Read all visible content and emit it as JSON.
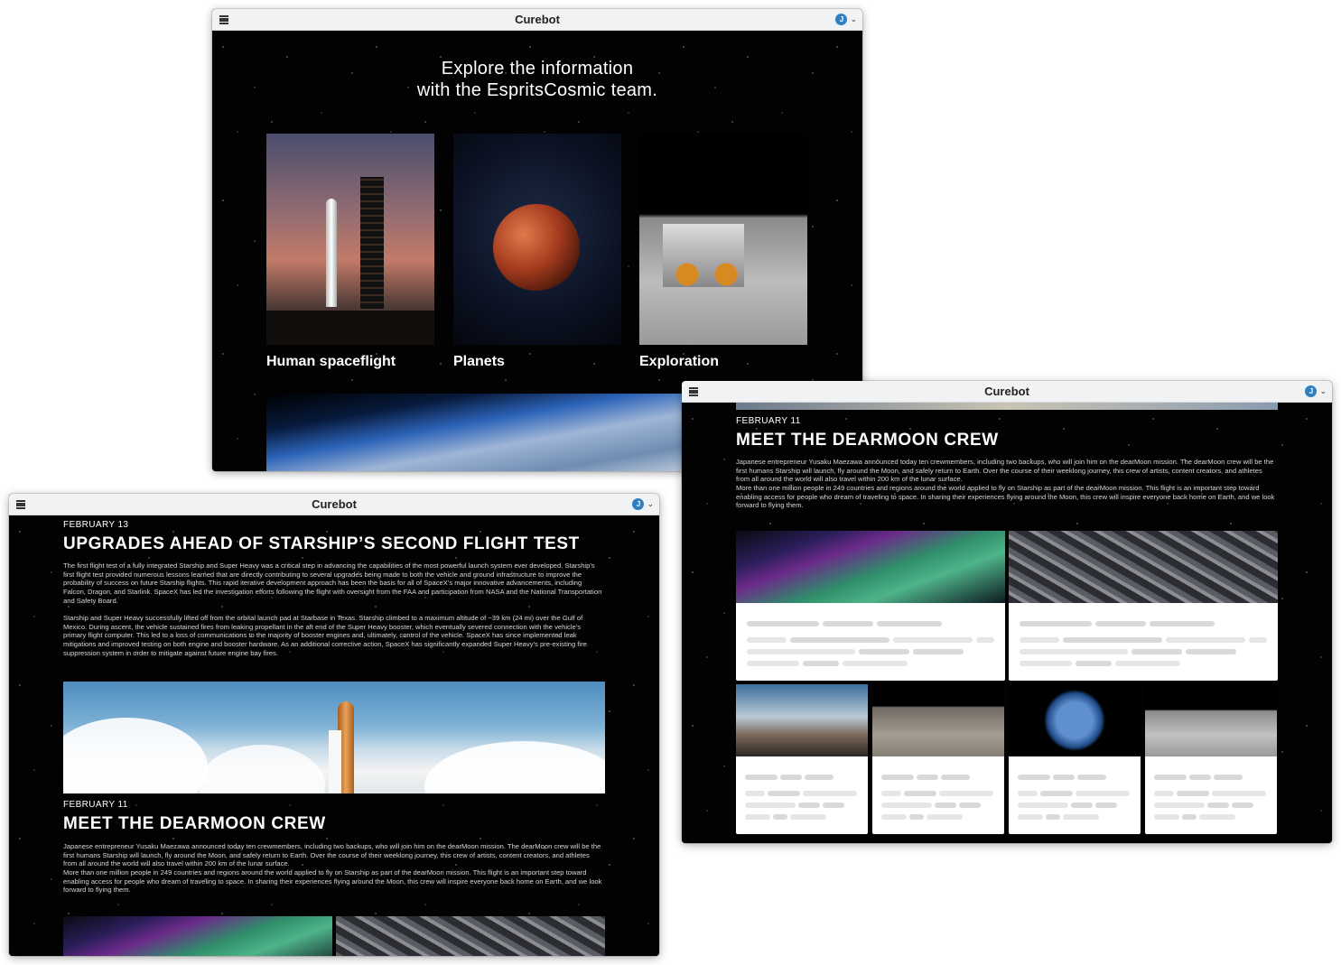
{
  "app": {
    "title": "Curebot",
    "avatar_initial": "J"
  },
  "window_home": {
    "hero_line1": "Explore the information",
    "hero_line2": "with the EspritsCosmic team.",
    "categories": [
      {
        "label": "Human spaceflight"
      },
      {
        "label": "Planets"
      },
      {
        "label": "Exploration"
      }
    ]
  },
  "articles": {
    "starship": {
      "date": "FEBRUARY 13",
      "title": "UPGRADES AHEAD OF STARSHIP’S SECOND FLIGHT TEST",
      "para1": "The first flight test of a fully integrated Starship and Super Heavy was a critical step in advancing the capabilities of the most powerful launch system ever developed. Starship’s first flight test provided numerous lessons learned that are directly contributing to several upgrades being made to both the vehicle and ground infrastructure to improve the probability of success on future Starship flights. This rapid iterative development approach has been the basis for all of SpaceX’s major innovative advancements, including Falcon, Dragon, and Starlink. SpaceX has led the investigation efforts following the flight with oversight from the FAA and participation from NASA and the National Transportation and Safety Board.",
      "para2": "Starship and Super Heavy successfully lifted off from the orbital launch pad at Starbase in Texas. Starship climbed to a maximum altitude of ~39 km (24 mi) over the Gulf of Mexico. During ascent, the vehicle sustained fires from leaking propellant in the aft end of the Super Heavy booster, which eventually severed connection with the vehicle’s primary flight computer. This led to a loss of communications to the majority of booster engines and, ultimately, control of the vehicle. SpaceX has since implemented leak mitigations and improved testing on both engine and booster hardware. As an additional corrective action, SpaceX has significantly expanded Super Heavy’s pre-existing fire suppression system in order to mitigate against future engine bay fires."
    },
    "dearmoon": {
      "date": "FEBRUARY 11",
      "title": "MEET THE DEARMOON CREW",
      "para1": "Japanese entrepreneur Yusaku Maezawa announced today ten crewmembers, including two backups, who will join him on the dearMoon mission. The dearMoon crew will be the first humans Starship will launch, fly around the Moon, and safely return to Earth. Over the course of their weeklong journey, this crew of artists, content creators, and athletes from all around the world will also travel within 200 km of the lunar surface.",
      "para2": "More than one million people in 249 countries and regions around the world applied to fly on Starship as part of the dearMoon mission. This flight is an important step toward enabling access for people who dream of traveling to space. In sharing their experiences flying around the Moon, this crew will inspire everyone back home on Earth, and we look forward to flying them."
    }
  }
}
